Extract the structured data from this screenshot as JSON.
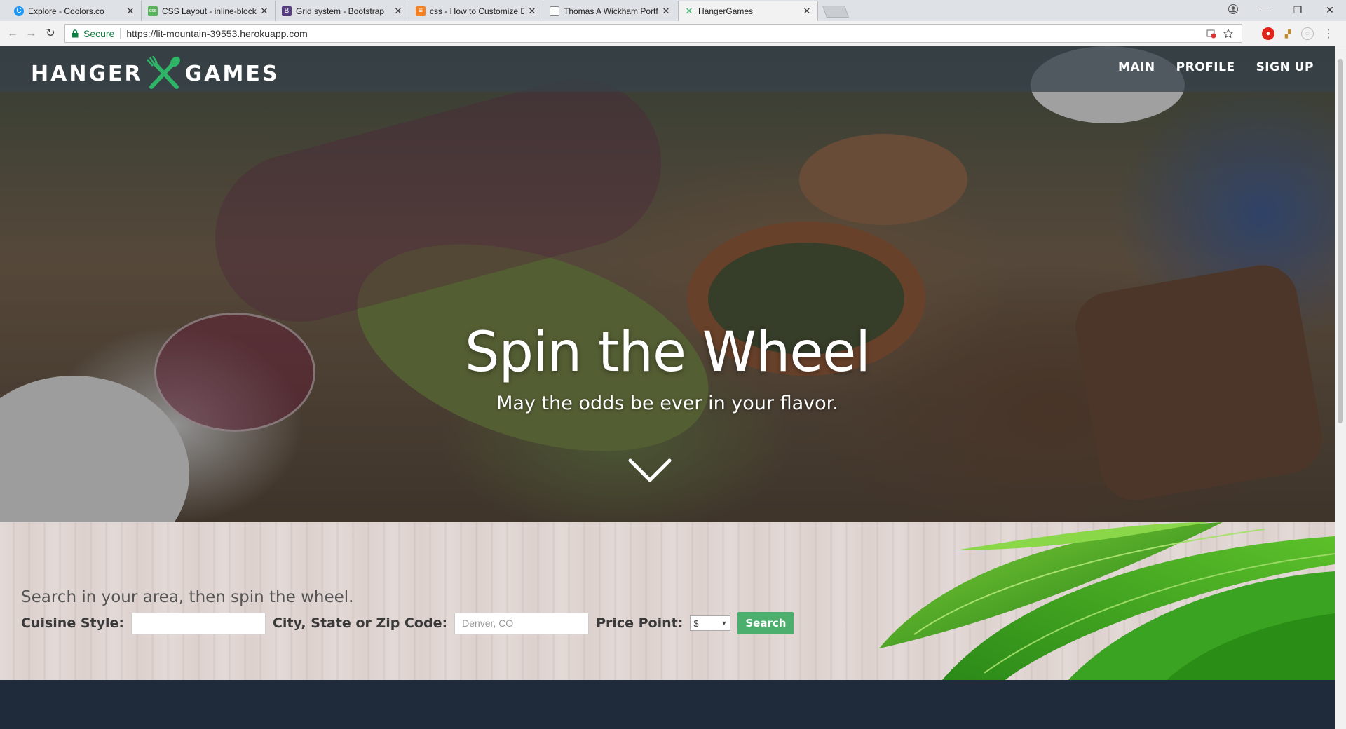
{
  "browser": {
    "tabs": [
      {
        "title": "Explore - Coolors.co",
        "favicon_color": "#2196f3",
        "favicon_glyph": "C"
      },
      {
        "title": "CSS Layout - inline-block",
        "favicon_color": "#5bb45b",
        "favicon_glyph": "css"
      },
      {
        "title": "Grid system - Bootstrap",
        "favicon_color": "#563d7c",
        "favicon_glyph": "B"
      },
      {
        "title": "css - How to Customize B",
        "favicon_color": "#f48024",
        "favicon_glyph": "≡"
      },
      {
        "title": "Thomas A Wickham Portf",
        "favicon_color": "#ffffff",
        "favicon_glyph": ""
      },
      {
        "title": "HangerGames",
        "favicon_color": "#2fb567",
        "favicon_glyph": "✕"
      }
    ],
    "active_tab_index": 5,
    "secure_label": "Secure",
    "url": "https://lit-mountain-39553.herokuapp.com"
  },
  "site": {
    "logo_left": "HANGER",
    "logo_right": "GAMES",
    "nav": [
      {
        "label": "MAIN"
      },
      {
        "label": "PROFILE"
      },
      {
        "label": "SIGN UP"
      }
    ],
    "hero_title": "Spin the Wheel",
    "hero_subtitle": "May the odds be ever in your flavor.",
    "search": {
      "intro": "Search in your area, then spin the wheel.",
      "cuisine_label": "Cuisine Style:",
      "cuisine_value": "",
      "location_label": "City, State or Zip Code:",
      "location_placeholder": "Denver, CO",
      "price_label": "Price Point:",
      "price_selected": "$",
      "button_label": "Search"
    }
  },
  "colors": {
    "accent_green": "#4caf6e",
    "dark_navy": "#1f2a3a"
  }
}
